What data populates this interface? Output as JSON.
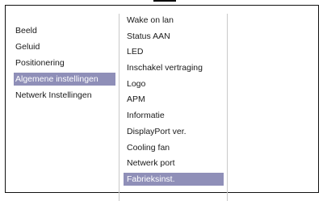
{
  "menu_left": {
    "items": [
      {
        "label": "Beeld"
      },
      {
        "label": "Geluid"
      },
      {
        "label": "Positionering"
      },
      {
        "label": "Algemene instellingen"
      },
      {
        "label": "Netwerk Instellingen"
      }
    ],
    "selected_index": 3
  },
  "menu_sub": {
    "items": [
      {
        "label": "Wake on lan"
      },
      {
        "label": "Status AAN"
      },
      {
        "label": "LED"
      },
      {
        "label": "Inschakel vertraging"
      },
      {
        "label": "Logo"
      },
      {
        "label": "APM"
      },
      {
        "label": "Informatie"
      },
      {
        "label": "DisplayPort ver."
      },
      {
        "label": "Cooling fan"
      },
      {
        "label": "Netwerk port"
      },
      {
        "label": "Fabrieksinst."
      }
    ],
    "selected_index": 10
  },
  "colors": {
    "highlight": "#8f8fb8",
    "highlight_text": "#ffffff",
    "text": "#1a1a1a",
    "divider": "#c9c9c9",
    "frame": "#111111"
  }
}
